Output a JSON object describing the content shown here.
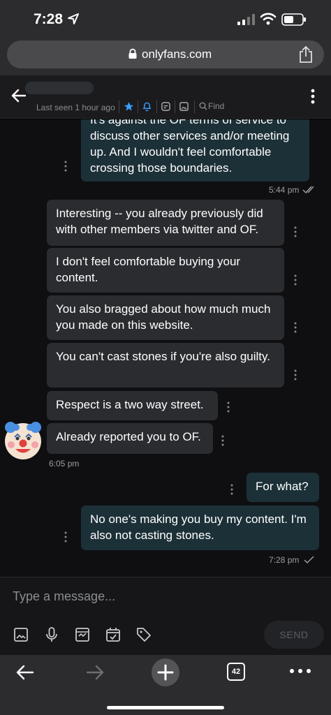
{
  "status_bar": {
    "time": "7:28"
  },
  "browser": {
    "url": "onlyfans.com"
  },
  "chat_header": {
    "last_seen": "Last seen 1 hour ago",
    "find_label": "Find"
  },
  "messages": [
    {
      "direction": "out",
      "text": "It's against the OF terms of service to discuss other services and/or meeting up. And I wouldn't feel comfortable crossing those boundaries."
    },
    {
      "direction": "out",
      "timestamp": "5:44 pm"
    },
    {
      "direction": "in",
      "text": "Interesting -- you already previously did with other members via twitter and OF."
    },
    {
      "direction": "in",
      "text": "I don't feel comfortable buying your content."
    },
    {
      "direction": "in",
      "text": "You also bragged about how much much you made on this website."
    },
    {
      "direction": "in",
      "text": "You can't cast stones if you're also guilty."
    },
    {
      "direction": "in",
      "text": "Respect is a two way street."
    },
    {
      "direction": "in",
      "text": "Already reported you to OF.",
      "timestamp": "6:05 pm"
    },
    {
      "direction": "out",
      "text": "For what?"
    },
    {
      "direction": "out",
      "text": "No one's making you buy my content. I'm also not casting stones.",
      "timestamp": "7:28 pm"
    }
  ],
  "composer": {
    "placeholder": "Type a message...",
    "send_label": "SEND"
  },
  "bottom_bar": {
    "tab_count": "42"
  },
  "colors": {
    "outgoing_bubble": "#1c3038",
    "incoming_bubble": "#2a2c30",
    "accent_blue": "#3aa0ff",
    "chat_background": "#0f0f12"
  },
  "icons": {
    "header": [
      "back-arrow-icon",
      "star-icon",
      "bell-icon",
      "chat-note-icon",
      "image-icon",
      "search-icon",
      "kebab-menu-icon"
    ],
    "composer": [
      "image-icon",
      "microphone-icon",
      "vault-icon",
      "calendar-check-icon",
      "price-tag-icon"
    ],
    "browser": [
      "back-arrow-icon",
      "forward-arrow-icon",
      "plus-icon",
      "tabs-icon",
      "more-icon"
    ]
  }
}
